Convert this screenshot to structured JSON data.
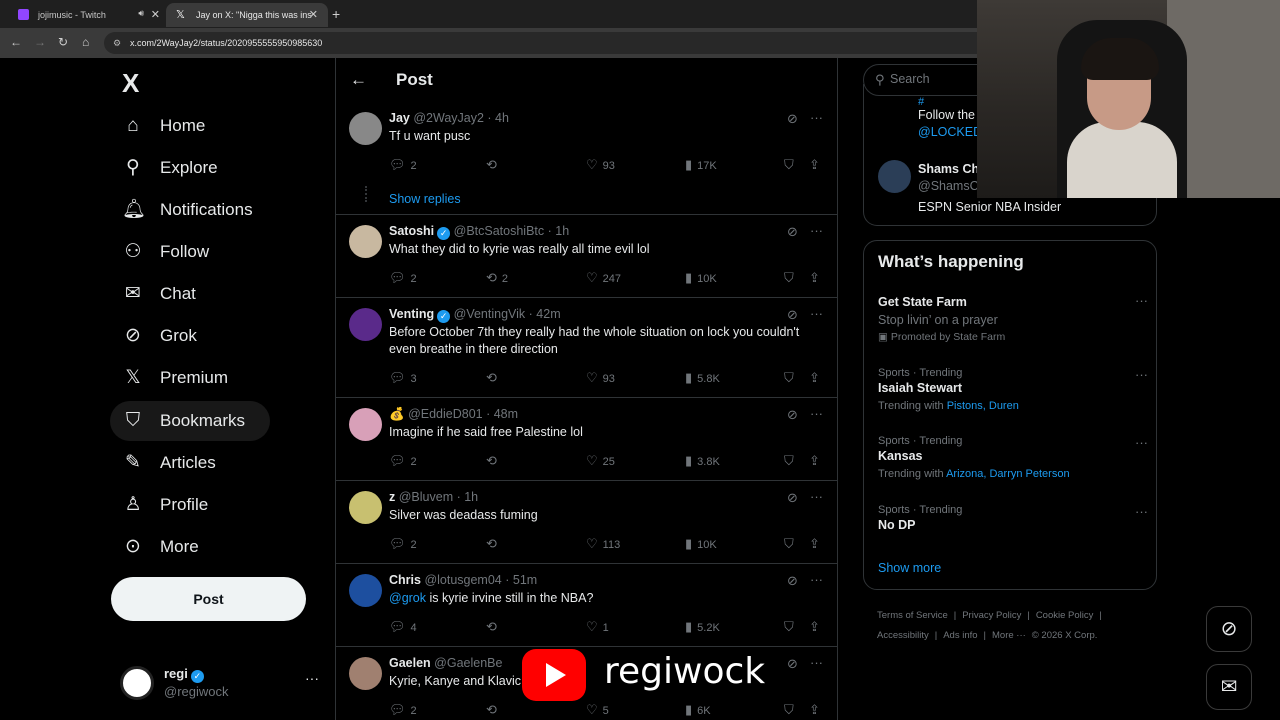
{
  "browser": {
    "tabs": [
      {
        "title": "jojimusic - Twitch",
        "active": false,
        "favicon_color": "#9146ff"
      },
      {
        "title": "Jay on X: \"Nigga this was ins",
        "active": true,
        "favicon_color": "#ffffff"
      }
    ],
    "url": "x.com/2WayJay2/status/2020955555950985630"
  },
  "sidebar": {
    "logo": "X",
    "items": [
      {
        "label": "Home",
        "icon": "home-icon",
        "glyph": "⌂"
      },
      {
        "label": "Explore",
        "icon": "search-icon",
        "glyph": "⚲"
      },
      {
        "label": "Notifications",
        "icon": "bell-icon",
        "glyph": "🔔︎"
      },
      {
        "label": "Follow",
        "icon": "person-plus-icon",
        "glyph": "⚇"
      },
      {
        "label": "Chat",
        "icon": "envelope-icon",
        "glyph": "✉"
      },
      {
        "label": "Grok",
        "icon": "grok-icon",
        "glyph": "⊘"
      },
      {
        "label": "Premium",
        "icon": "x-logo-icon",
        "glyph": "𝕏"
      },
      {
        "label": "Bookmarks",
        "icon": "bookmark-icon",
        "glyph": "⛉"
      },
      {
        "label": "Articles",
        "icon": "article-icon",
        "glyph": "✎"
      },
      {
        "label": "Profile",
        "icon": "person-icon",
        "glyph": "♙"
      },
      {
        "label": "More",
        "icon": "more-circle-icon",
        "glyph": "⊙"
      }
    ],
    "post_button": "Post",
    "account": {
      "name": "regi",
      "handle": "@regiwock"
    }
  },
  "main": {
    "title": "Post",
    "show_replies": "Show replies",
    "tweets": [
      {
        "name": "Jay",
        "verified": false,
        "handle": "@2WayJay2",
        "time": "4h",
        "text": "Tf u want pusc",
        "replies": "2",
        "reposts": "",
        "likes": "93",
        "views": "17K",
        "avatar_color": "#888"
      },
      {
        "name": "Satoshi",
        "verified": true,
        "handle": "@BtcSatoshiBtc",
        "time": "1h",
        "text": "What they did to kyrie was really all time evil lol",
        "replies": "2",
        "reposts": "2",
        "likes": "247",
        "views": "10K",
        "avatar_color": "#c8b8a0"
      },
      {
        "name": "Venting",
        "verified": true,
        "handle": "@VentingVik",
        "time": "42m",
        "text": "Before October 7th they really had the whole situation on lock you couldn't even breathe in there direction",
        "replies": "3",
        "reposts": "",
        "likes": "93",
        "views": "5.8K",
        "avatar_color": "#5a2a8a"
      },
      {
        "name": "💰",
        "verified": false,
        "handle": "@EddieD801",
        "time": "48m",
        "text": "Imagine if he said free Palestine lol",
        "replies": "2",
        "reposts": "",
        "likes": "25",
        "views": "3.8K",
        "avatar_color": "#d8a0b8"
      },
      {
        "name": "z",
        "verified": false,
        "handle": "@Bluvem",
        "time": "1h",
        "text": "Silver was deadass fuming",
        "replies": "2",
        "reposts": "",
        "likes": "113",
        "views": "10K",
        "avatar_color": "#c8c070"
      },
      {
        "name": "Chris",
        "verified": false,
        "handle": "@lotusgem04",
        "time": "51m",
        "mention": "@grok",
        "text": " is kyrie irvine still in the NBA?",
        "replies": "4",
        "reposts": "",
        "likes": "1",
        "views": "5.2K",
        "avatar_color": "#1d4f9f"
      },
      {
        "name": "Gaelen",
        "verified": false,
        "handle": "@GaelenBe",
        "time": "",
        "text": "Kyrie, Kanye and Klavic",
        "replies": "2",
        "reposts": "",
        "likes": "5",
        "views": "6K",
        "avatar_color": "#a08070"
      }
    ]
  },
  "right": {
    "search_placeholder": "Search",
    "follow_card": {
      "line1": "#",
      "line2": "Follow the",
      "line3": "@LOCKED",
      "name": "Shams Ch",
      "handle": "@ShamsC",
      "bio": "ESPN Senior NBA Insider"
    },
    "happening": {
      "title": "What’s happening",
      "trends": [
        {
          "context": "",
          "title": "Get State Farm",
          "subtitle": "Stop livin’ on a prayer",
          "promo": "Promoted by State Farm",
          "trending_with_label": "",
          "trending_with": ""
        },
        {
          "context": "Sports · Trending",
          "title": "Isaiah Stewart",
          "subtitle": "",
          "promo": "",
          "trending_with_label": "Trending with",
          "trending_with": "Pistons, Duren"
        },
        {
          "context": "Sports · Trending",
          "title": "Kansas",
          "subtitle": "",
          "promo": "",
          "trending_with_label": "Trending with",
          "trending_with": "Arizona, Darryn Peterson"
        },
        {
          "context": "Sports · Trending",
          "title": "No DP",
          "subtitle": "",
          "promo": "",
          "trending_with_label": "",
          "trending_with": ""
        }
      ],
      "show_more": "Show more"
    },
    "footer": [
      "Terms of Service",
      "|",
      "Privacy Policy",
      "|",
      "Cookie Policy",
      "|",
      "Accessibility",
      "|",
      "Ads info",
      "|",
      "More ···",
      "© 2026 X Corp."
    ]
  },
  "overlay": {
    "watermark": "regiwock"
  }
}
